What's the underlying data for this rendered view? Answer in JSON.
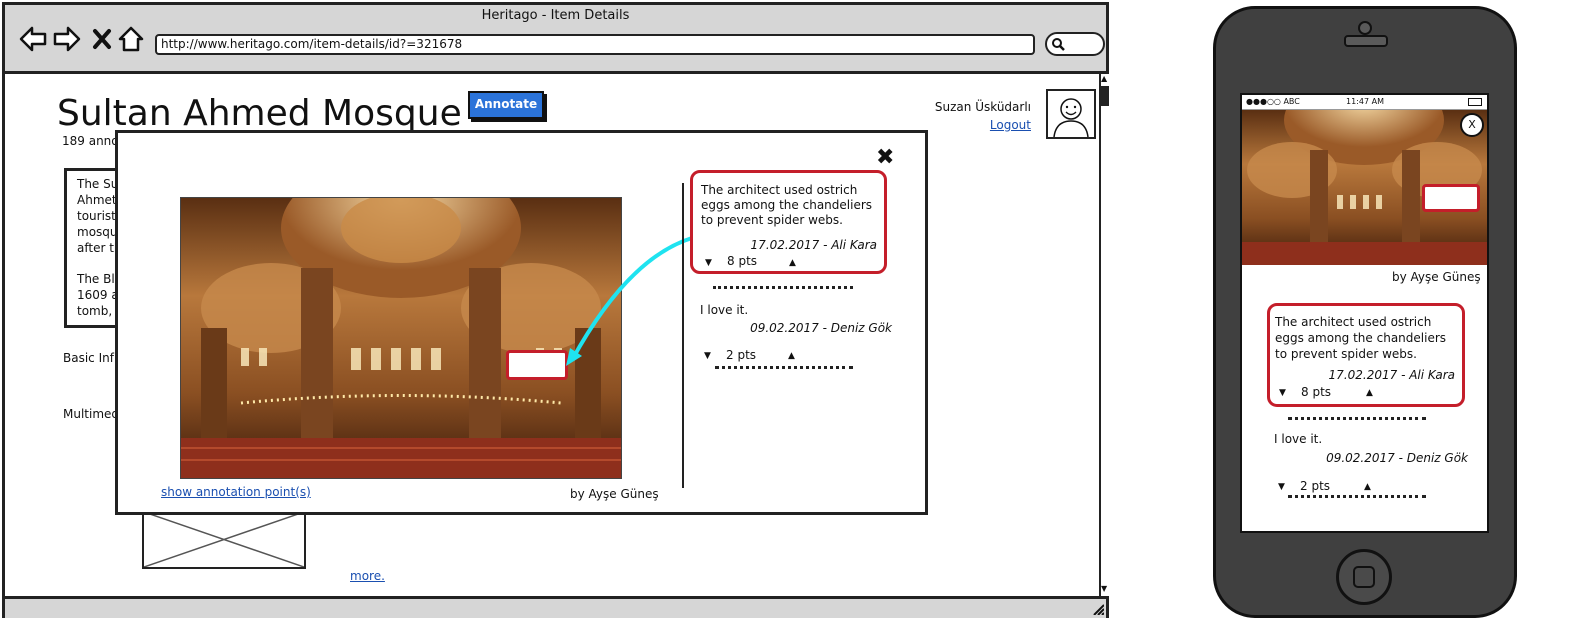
{
  "browser": {
    "title": "Heritago - Item Details",
    "url": "http://www.heritago.com/item-details/id?=321678"
  },
  "page": {
    "title": "Sultan Ahmed Mosque",
    "annotations_count": "189 anno",
    "annotate_button": "Annotate",
    "user_name": "Suzan Üsküdarlı",
    "logout": "Logout",
    "description": [
      "The Su Ahmet tourist mosqu after th",
      "The Blu 1609 a tomb, a"
    ],
    "description_lines_1": [
      "The Su",
      "Ahmet",
      "tourist",
      "mosqu",
      "after th"
    ],
    "description_lines_2": [
      "The Blu",
      "1609 a",
      "tomb, a"
    ],
    "basic_info": "Basic Inf",
    "multimedia": "Multimed",
    "more_link": "more."
  },
  "modal": {
    "show_points": "show annotation point(s)",
    "byline": "by Ayşe Güneş",
    "annotations": [
      {
        "text": "The architect used ostrich eggs among the chandeliers to prevent spider webs.",
        "meta": "17.02.2017 - Ali Kara",
        "points": "8 pts"
      },
      {
        "text": "I love it.",
        "meta": "09.02.2017 - Deniz Gök",
        "points": "2 pts"
      }
    ]
  },
  "phone": {
    "carrier": "●●●○○ ABC",
    "time": "11:47 AM",
    "close": "X",
    "byline": "by Ayşe Güneş",
    "annotations": [
      {
        "text": "The architect used ostrich eggs among the chandeliers to prevent spider webs.",
        "meta": "17.02.2017 - Ali Kara",
        "points": "8 pts"
      },
      {
        "text": "I love it.",
        "meta": "09.02.2017 - Deniz Gök",
        "points": "2 pts"
      }
    ]
  },
  "colors": {
    "accent_blue": "#2b73d9",
    "annotation_red": "#c41e2a",
    "arrow_cyan": "#1fe3f0",
    "link_blue": "#1a4fb0"
  }
}
